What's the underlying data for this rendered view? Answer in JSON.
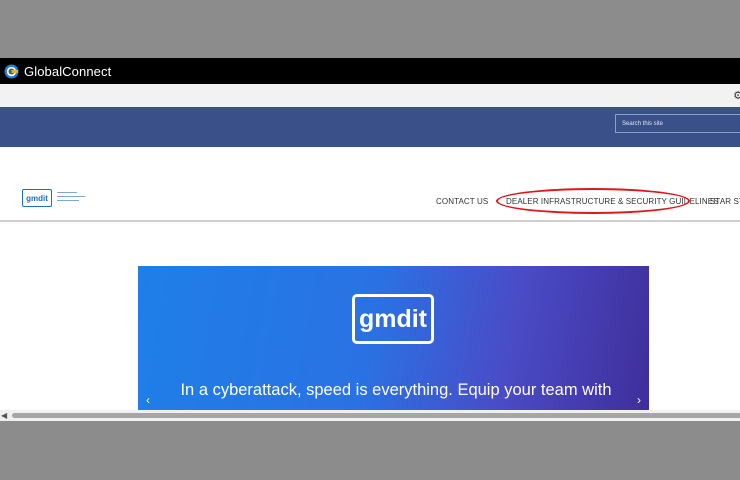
{
  "window": {
    "title": "GlobalConnect",
    "logo_icon": "globalconnect-logo-icon"
  },
  "toolbar": {
    "settings_icon": "gear-icon"
  },
  "header": {
    "search_placeholder": "Search this site"
  },
  "brand": {
    "text": "gmdit"
  },
  "nav": {
    "items": [
      {
        "label": "CONTACT US"
      },
      {
        "label": "DEALER INFRASTRUCTURE & SECURITY GUIDELINES"
      },
      {
        "label": "STAR STA"
      }
    ],
    "highlight_color": "#e0161b"
  },
  "banner": {
    "logo_text": "gmdit",
    "headline": "In a cyberattack, speed is everything. Equip your team with",
    "prev_icon": "chevron-left-icon",
    "next_icon": "chevron-right-icon"
  },
  "colors": {
    "band": "#3a5088",
    "titlebar": "#000000",
    "brand_blue": "#1e6fbf"
  }
}
